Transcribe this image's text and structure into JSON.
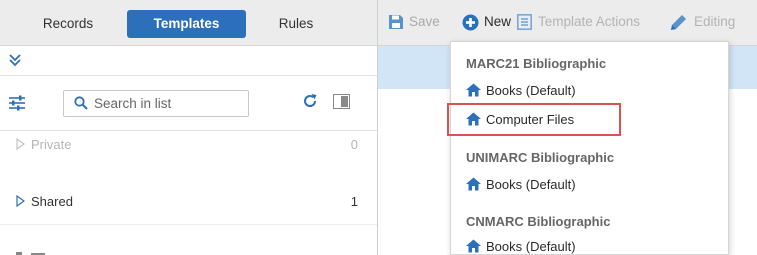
{
  "tabs": {
    "records": "Records",
    "templates": "Templates",
    "rules": "Rules"
  },
  "search": {
    "placeholder": "Search in list"
  },
  "groups": {
    "private": {
      "label": "Private",
      "count": "0"
    },
    "shared": {
      "label": "Shared",
      "count": "1"
    }
  },
  "toolbar": {
    "save": "Save",
    "new": "New",
    "template_actions": "Template Actions",
    "editing": "Editing"
  },
  "dropdown": {
    "sections": [
      {
        "header": "MARC21 Bibliographic",
        "items": [
          "Books (Default)",
          "Computer Files"
        ]
      },
      {
        "header": "UNIMARC Bibliographic",
        "items": [
          "Books (Default)"
        ]
      },
      {
        "header": "CNMARC Bibliographic",
        "items": [
          "Books (Default)"
        ]
      }
    ]
  },
  "colors": {
    "accent": "#2c6fbb",
    "selection_strip": "#d2e5f7",
    "highlight_border": "#d9534f",
    "toolbar_bg": "#ececec"
  },
  "icons": {
    "collapse": "double-chevron-down-icon",
    "filter": "sliders-icon",
    "search": "search-icon",
    "refresh": "refresh-icon",
    "panel": "panel-toggle-icon",
    "save": "floppy-disk-icon",
    "new": "plus-circle-icon",
    "template_actions": "list-icon",
    "editing": "pencil-icon",
    "template": "home-icon"
  }
}
